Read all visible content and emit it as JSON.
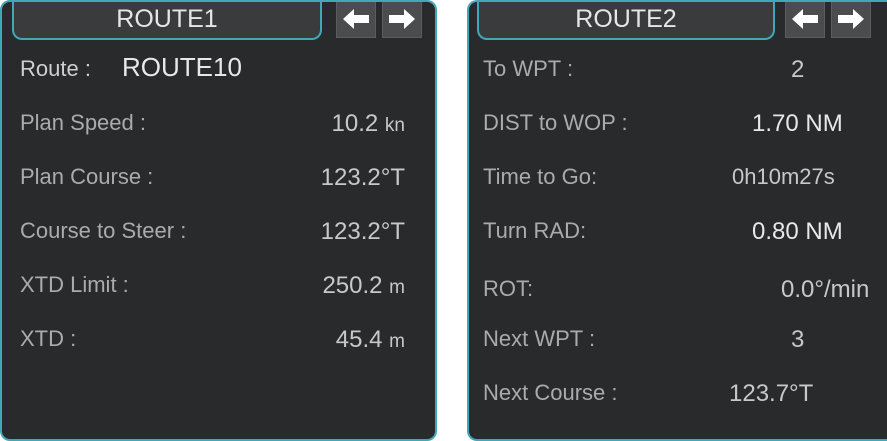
{
  "panel1": {
    "tab_title": "ROUTE1",
    "route_label": "Route :",
    "route_name": "ROUTE10",
    "rows": [
      {
        "label": "Plan Speed :",
        "value": "10.2",
        "unit": "kn"
      },
      {
        "label": "Plan Course :",
        "value": "123.2°T",
        "unit": ""
      },
      {
        "label": "Course to Steer :",
        "value": "123.2°T",
        "unit": ""
      },
      {
        "label": "XTD Limit :",
        "value": "250.2",
        "unit": "m"
      },
      {
        "label": "XTD :",
        "value": "45.4",
        "unit": "m"
      }
    ]
  },
  "panel2": {
    "tab_title": "ROUTE2",
    "rows": [
      {
        "label": "To WPT :",
        "value": "2",
        "unit": ""
      },
      {
        "label": "DIST to WOP :",
        "value": "1.70 NM",
        "unit": ""
      },
      {
        "label": "Time to Go:",
        "value": "0h10m27s",
        "unit": ""
      },
      {
        "label": "Turn RAD:",
        "value": "0.80 NM",
        "unit": ""
      },
      {
        "label": "ROT:",
        "value": "0.0°/min",
        "unit": ""
      },
      {
        "label": "Next WPT :",
        "value": "3",
        "unit": ""
      },
      {
        "label": "Next Course :",
        "value": "123.7°T",
        "unit": ""
      }
    ]
  },
  "icons": {
    "left": "arrow-left-icon",
    "right": "arrow-right-icon"
  },
  "colors": {
    "panel_bg": "#282a2c",
    "border_accent": "#3fa9b8",
    "label_text": "#a9abad",
    "value_text": "#e8e8e8"
  }
}
